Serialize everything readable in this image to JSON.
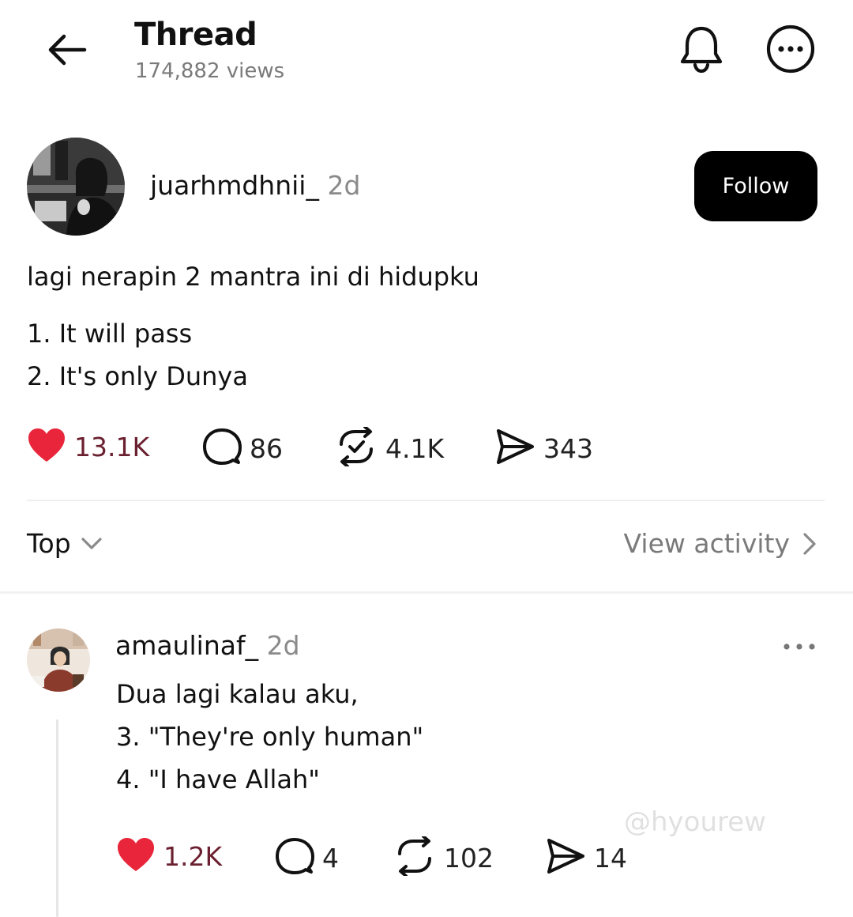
{
  "header": {
    "title": "Thread",
    "views": "174,882 views",
    "back_icon": "arrow-left-icon",
    "bell_icon": "bell-icon",
    "more_icon": "more-circle-icon"
  },
  "post": {
    "username": "juarhmdhnii_",
    "time": "2d",
    "follow_label": "Follow",
    "lines": [
      "lagi nerapin 2 mantra ini di hidupku",
      "1. It will pass",
      "2. It's only Dunya"
    ],
    "actions": {
      "likes": "13.1K",
      "replies": "86",
      "reposts": "4.1K",
      "shares": "343"
    }
  },
  "replies_bar": {
    "sort_label": "Top",
    "view_activity_label": "View activity"
  },
  "reply": {
    "username": "amaulinaf_",
    "time": "2d",
    "lines": [
      "Dua lagi kalau aku,",
      "3. \"They're only human\"",
      "4. \"I have Allah\""
    ],
    "actions": {
      "likes": "1.2K",
      "replies": "4",
      "reposts": "102",
      "shares": "14"
    }
  },
  "watermark": "@hyourew",
  "colors": {
    "heart": "#e8253a",
    "like_count": "#6b2030",
    "follow_bg": "#000000",
    "muted_text": "#7a7a7a"
  }
}
